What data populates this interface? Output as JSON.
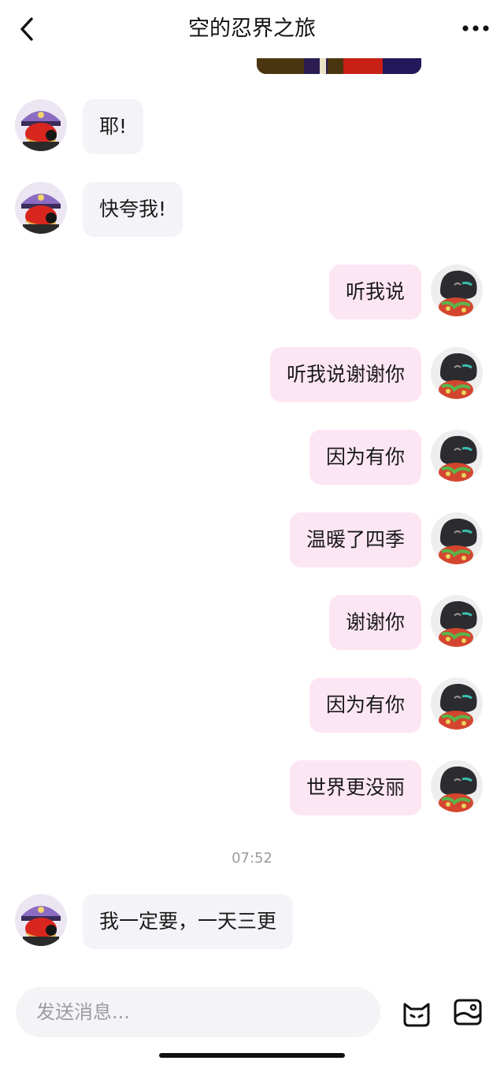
{
  "header": {
    "title": "空的忍界之旅",
    "back_icon": "chevron-left-icon",
    "more_icon": "more-dots-icon"
  },
  "messages": [
    {
      "side": "left",
      "text": "耶!"
    },
    {
      "side": "left",
      "text": "快夸我!"
    },
    {
      "side": "right",
      "text": "听我说"
    },
    {
      "side": "right",
      "text": "听我说谢谢你"
    },
    {
      "side": "right",
      "text": "因为有你"
    },
    {
      "side": "right",
      "text": "温暖了四季"
    },
    {
      "side": "right",
      "text": "谢谢你"
    },
    {
      "side": "right",
      "text": "因为有你"
    },
    {
      "side": "right",
      "text": "世界更没丽"
    },
    {
      "side": "left",
      "text": "我一定要，一天三更"
    }
  ],
  "timestamp": "07:52",
  "composer": {
    "placeholder": "发送消息...",
    "emoji_icon": "cat-emoji-icon",
    "image_icon": "image-icon"
  },
  "colors": {
    "incoming_bubble": "#f4f4f8",
    "outgoing_bubble": "#fde6f4",
    "input_bg": "#f4f4f7"
  }
}
